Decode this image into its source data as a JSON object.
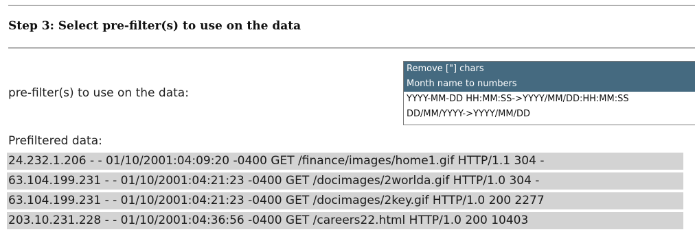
{
  "step": {
    "title": "Step 3: Select pre-filter(s) to use on the data"
  },
  "prefilter": {
    "label": "pre-filter(s) to use on the data:",
    "options": [
      {
        "label": "Remove [\"] chars",
        "selected": true
      },
      {
        "label": "Month name to numbers",
        "selected": true
      },
      {
        "label": "YYYY-MM-DD HH:MM:SS->YYYY/MM/DD:HH:MM:SS",
        "selected": false
      },
      {
        "label": "DD/MM/YYYY->YYYY/MM/DD",
        "selected": false
      }
    ]
  },
  "prefiltered": {
    "label": "Prefiltered data:",
    "rows": [
      "24.232.1.206 - - 01/10/2001:04:09:20 -0400 GET /finance/images/home1.gif HTTP/1.1 304 -",
      "63.104.199.231 - - 01/10/2001:04:21:23 -0400 GET /docimages/2worlda.gif HTTP/1.0 304 -",
      "63.104.199.231 - - 01/10/2001:04:21:23 -0400 GET /docimages/2key.gif HTTP/1.0 200 2277",
      "203.10.231.228 - - 01/10/2001:04:36:56 -0400 GET /careers22.html HTTP/1.0 200 10403"
    ]
  },
  "colors": {
    "selected_option_bg": "#456a80",
    "row_bg": "#d3d3d3",
    "rule": "#b0b0b0"
  }
}
